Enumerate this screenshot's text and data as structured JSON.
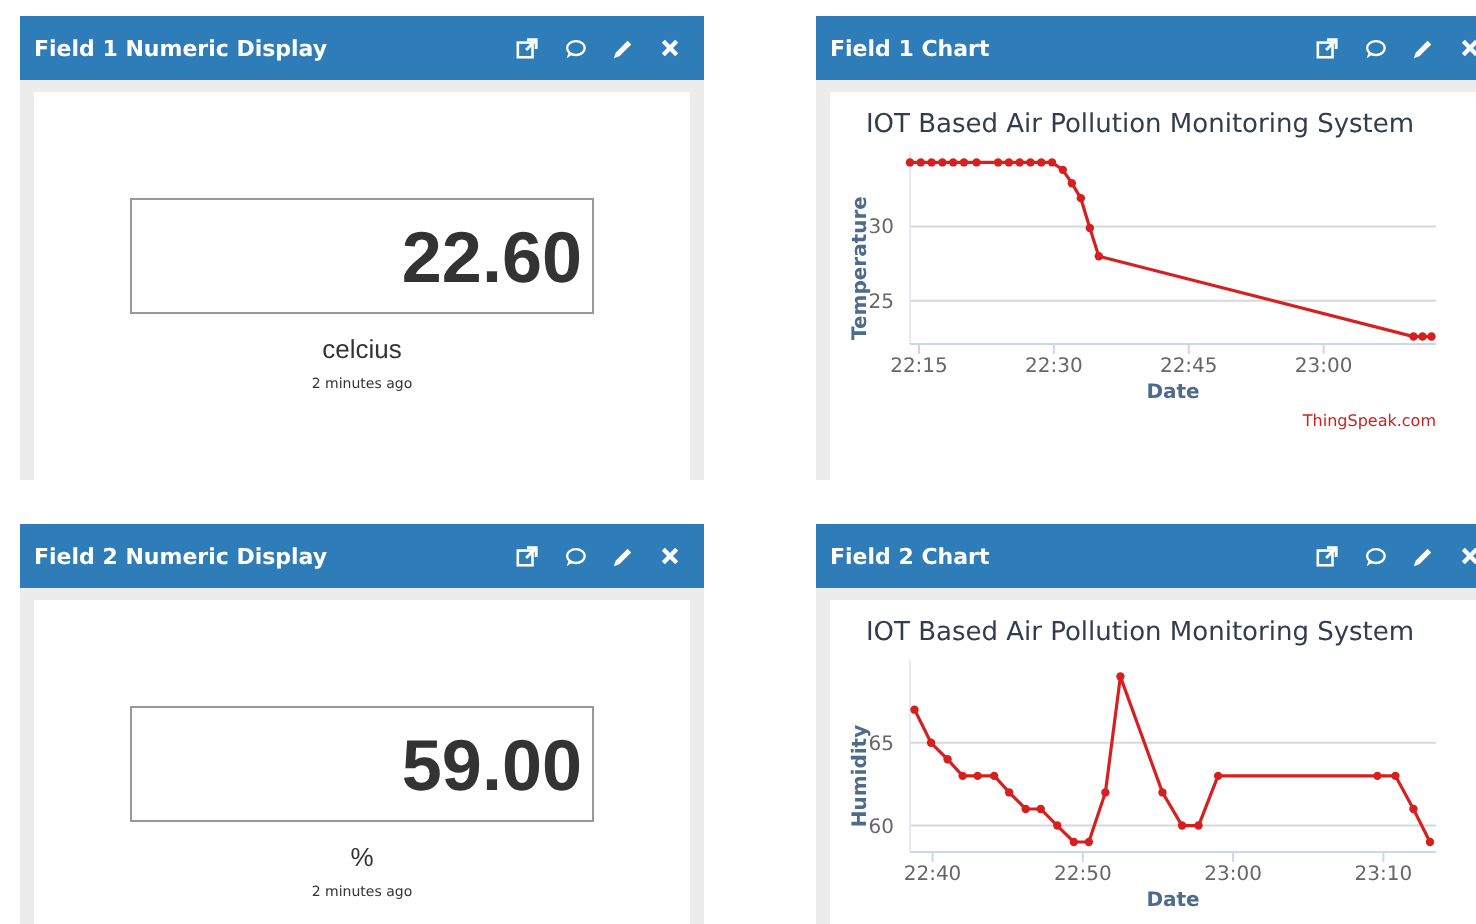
{
  "panels": [
    {
      "kind": "numeric",
      "title": "Field 1 Numeric Display",
      "value": "22.60",
      "unit": "celcius",
      "updated": "2 minutes ago"
    },
    {
      "kind": "chart",
      "title": "Field 1 Chart",
      "credit": "ThingSpeak.com",
      "chart_data": {
        "type": "line",
        "title": "IOT Based Air Pollution Monitoring System",
        "xlabel": "Date",
        "ylabel": "Temperature",
        "ylim": [
          22.1,
          35
        ],
        "xlim": [
          1334,
          1392.5
        ],
        "xticks": [
          {
            "value": 1335,
            "label": "22:15"
          },
          {
            "value": 1350,
            "label": "22:30"
          },
          {
            "value": 1365,
            "label": "22:45"
          },
          {
            "value": 1380,
            "label": "23:00"
          }
        ],
        "yticks": [
          25,
          30
        ],
        "x": [
          1334,
          1335.2,
          1336.4,
          1337.6,
          1338.8,
          1340,
          1341.4,
          1343.8,
          1345,
          1346.2,
          1347.4,
          1348.6,
          1349.8,
          1351,
          1352,
          1353,
          1354,
          1355,
          1390,
          1391,
          1392
        ],
        "series": [
          {
            "color": "#d62020",
            "marker": "circle",
            "values": [
              34.3,
              34.3,
              34.3,
              34.3,
              34.3,
              34.3,
              34.3,
              34.3,
              34.3,
              34.3,
              34.3,
              34.3,
              34.3,
              33.8,
              32.9,
              31.9,
              29.9,
              28,
              22.6,
              22.6,
              22.6
            ]
          }
        ]
      }
    },
    {
      "kind": "numeric",
      "title": "Field 2 Numeric Display",
      "value": "59.00",
      "unit": "%",
      "updated": "2 minutes ago"
    },
    {
      "kind": "chart",
      "title": "Field 2 Chart",
      "chart_data": {
        "type": "line",
        "title": "IOT Based Air Pollution Monitoring System",
        "xlabel": "Date",
        "ylabel": "Humidity",
        "ylim": [
          58.4,
          70
        ],
        "xlim": [
          1358.5,
          1393.5
        ],
        "xticks": [
          {
            "value": 1360,
            "label": "22:40"
          },
          {
            "value": 1370,
            "label": "22:50"
          },
          {
            "value": 1380,
            "label": "23:00"
          },
          {
            "value": 1390,
            "label": "23:10"
          }
        ],
        "yticks": [
          60,
          65
        ],
        "x": [
          1358.8,
          1359.9,
          1361,
          1362,
          1363,
          1364.1,
          1365.1,
          1366.2,
          1367.2,
          1368.3,
          1369.4,
          1370.4,
          1371.5,
          1372.5,
          1375.3,
          1376.6,
          1377.7,
          1379,
          1389.6,
          1390.8,
          1392,
          1393.1
        ],
        "series": [
          {
            "color": "#d62020",
            "marker": "circle",
            "values": [
              67,
              65,
              64,
              63,
              63,
              63,
              62,
              61,
              61,
              60,
              59,
              59,
              62,
              69,
              62,
              60,
              60,
              63,
              63,
              63,
              61,
              59
            ]
          }
        ]
      }
    }
  ]
}
